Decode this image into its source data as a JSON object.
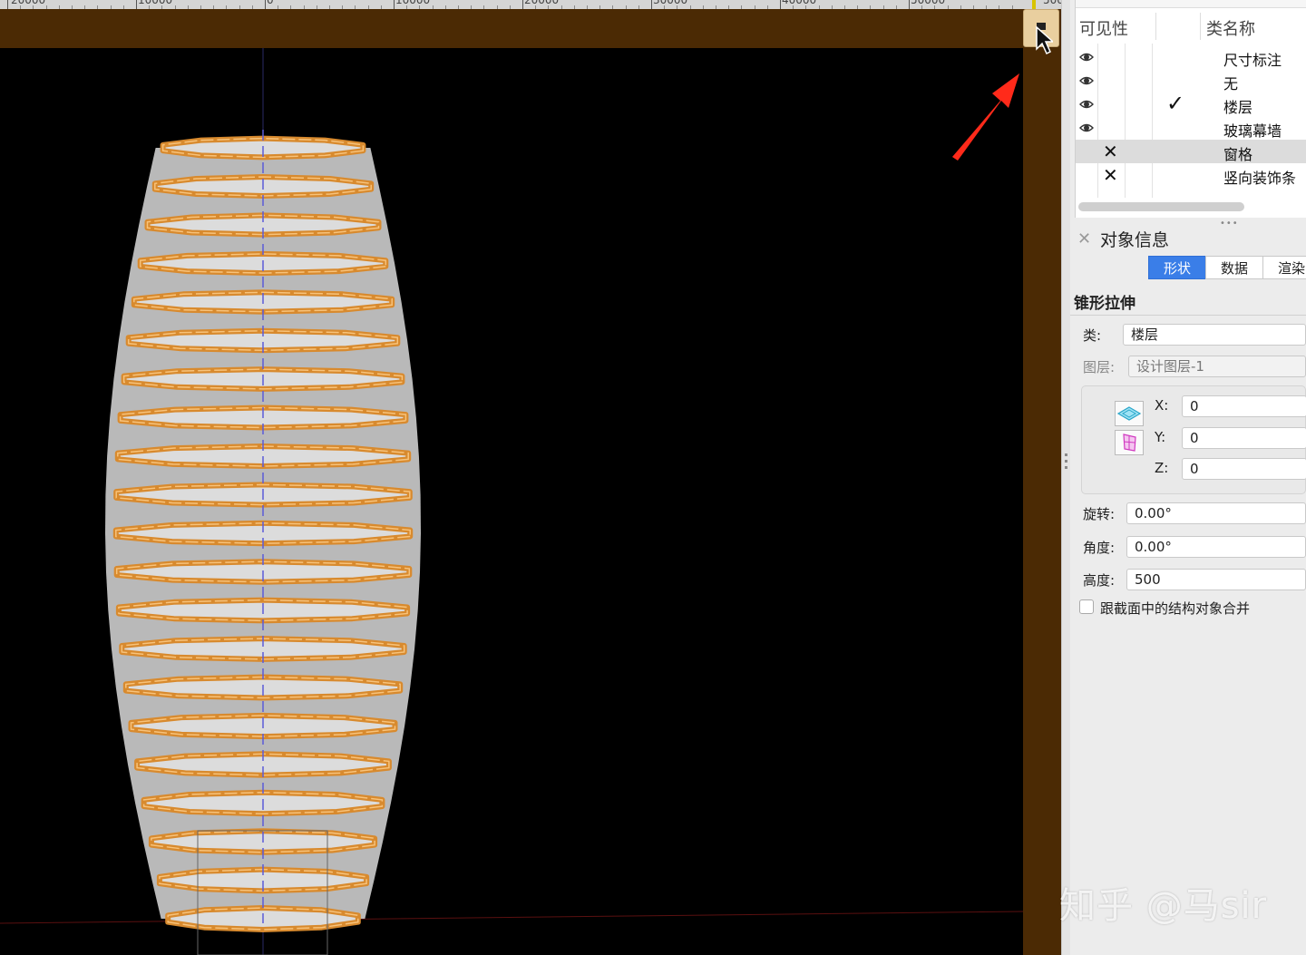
{
  "ruler": {
    "labels": [
      "20000",
      "10000",
      "0",
      "10000",
      "20000",
      "30000",
      "40000",
      "50000"
    ],
    "strip_label": "500"
  },
  "class_list": {
    "header_visibility": "可见性",
    "header_class_name": "类名称",
    "rows": [
      {
        "name": "尺寸标注",
        "visible": true,
        "hidden": false,
        "active": false,
        "selected": false
      },
      {
        "name": "无",
        "visible": true,
        "hidden": false,
        "active": false,
        "selected": false
      },
      {
        "name": "楼层",
        "visible": true,
        "hidden": false,
        "active": true,
        "selected": false
      },
      {
        "name": "玻璃幕墙",
        "visible": true,
        "hidden": false,
        "active": false,
        "selected": false
      },
      {
        "name": "窗格",
        "visible": false,
        "hidden": true,
        "active": false,
        "selected": true
      },
      {
        "name": "竖向装饰条",
        "visible": false,
        "hidden": true,
        "active": false,
        "selected": false
      }
    ],
    "check_glyph": "✓",
    "cross_glyph": "✕"
  },
  "object_info": {
    "title": "对象信息",
    "close_glyph": "✕",
    "tabs": [
      {
        "label": "形状",
        "active": true
      },
      {
        "label": "数据",
        "active": false
      },
      {
        "label": "渲染",
        "active": false
      }
    ],
    "shape_title": "锥形拉伸",
    "class_label": "类:",
    "class_value": "楼层",
    "layer_label": "图层:",
    "layer_value": "设计图层-1",
    "x_label": "X:",
    "x_value": "0",
    "y_label": "Y:",
    "y_value": "0",
    "z_label": "Z:",
    "z_value": "0",
    "rotation_label": "旋转:",
    "rotation_value": "0.00°",
    "angle_label": "角度:",
    "angle_value": "0.00°",
    "height_label": "高度:",
    "height_value": "500",
    "merge_label": "跟截面中的结构对象合并",
    "merge_checked": false
  },
  "watermark": "知乎 @马sir",
  "colors": {
    "viewport_bg": "#000000",
    "toolbar_brown": "#4b2a04",
    "ring_orange": "#d88a2e",
    "ring_highlight": "#f7c27a",
    "tower_gray": "#b9b9b9",
    "tab_active": "#3a7ee8",
    "arrow_red": "#ff2a1a"
  },
  "scene": {
    "floor_count": 21
  }
}
